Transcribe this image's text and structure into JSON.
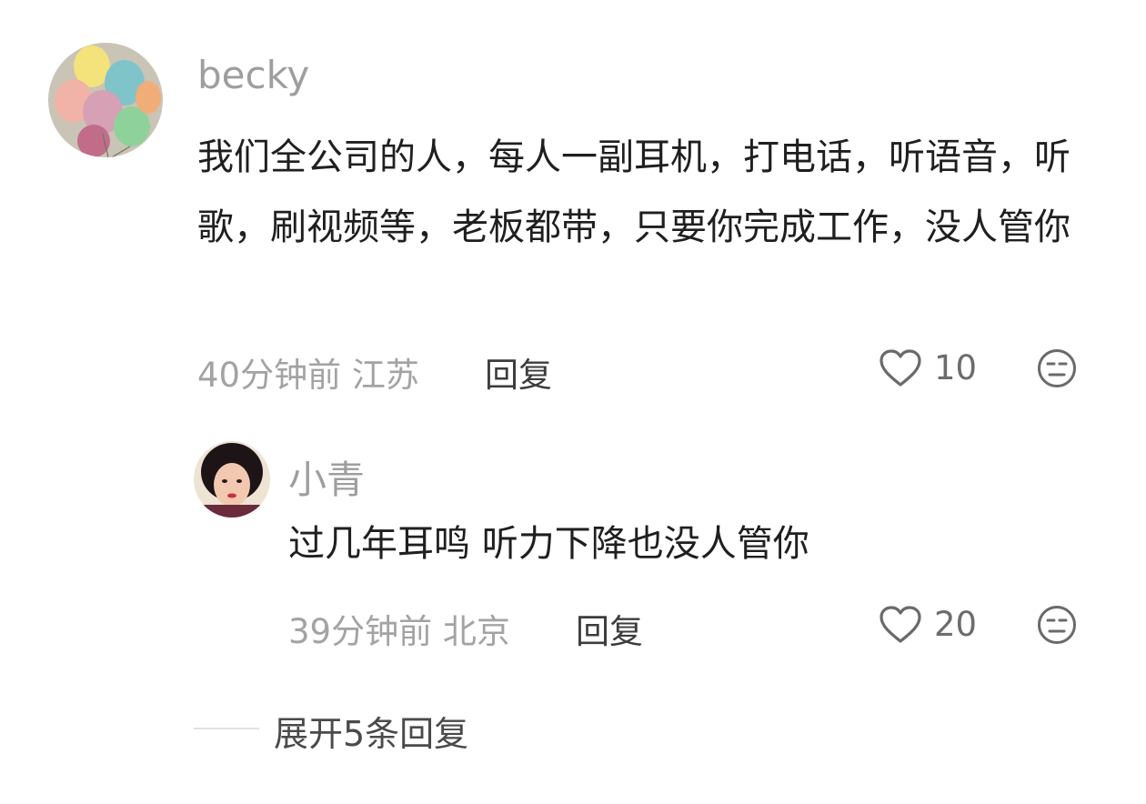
{
  "comments": [
    {
      "username": "becky",
      "text": "我们全公司的人，每人一副耳机，打电话，听语音，听歌，刷视频等，老板都带，只要你完成工作，没人管你",
      "time_location": "40分钟前 江苏",
      "reply_label": "回复",
      "likes": "10",
      "avatar_icon": "balloons-avatar",
      "like_icon": "heart-outline-icon",
      "dislike_icon": "unamused-face-icon"
    },
    {
      "username": "小青",
      "text": "过几年耳鸣 听力下降也没人管你",
      "time_location": "39分钟前 北京",
      "reply_label": "回复",
      "likes": "20",
      "avatar_icon": "woman-portrait-avatar",
      "like_icon": "heart-outline-icon",
      "dislike_icon": "unamused-face-icon"
    }
  ],
  "expand_replies": "展开5条回复"
}
